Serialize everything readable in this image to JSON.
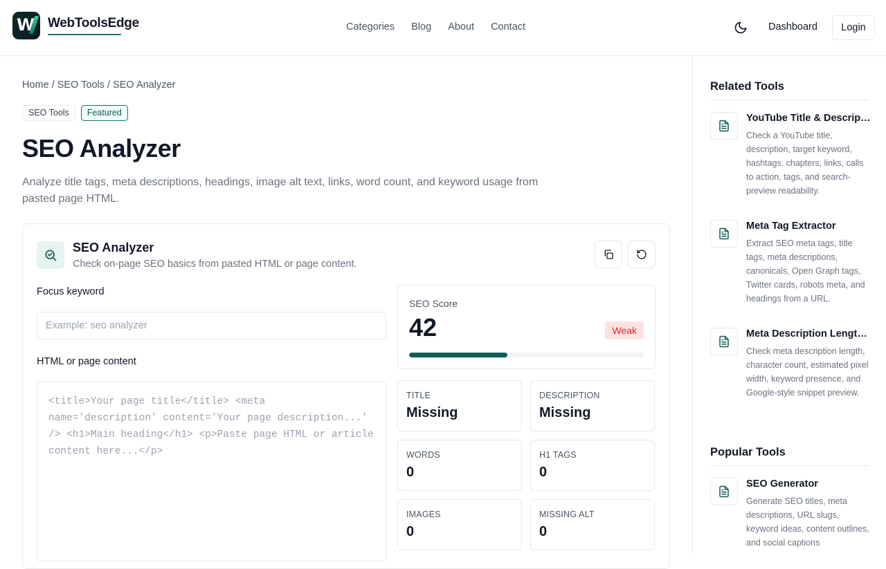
{
  "brand": {
    "name": "WebToolsEdge",
    "logo_letter": "W"
  },
  "nav": {
    "items": [
      "Categories",
      "Blog",
      "About",
      "Contact"
    ]
  },
  "header": {
    "theme_icon": "moon-icon",
    "dashboard_label": "Dashboard",
    "login_label": "Login"
  },
  "breadcrumb": "Home / SEO Tools / SEO Analyzer",
  "badges": [
    "SEO Tools",
    "Featured"
  ],
  "page": {
    "title": "SEO Analyzer",
    "subtitle": "Analyze title tags, meta descriptions, headings, image alt text, links, word count, and keyword usage from pasted page HTML."
  },
  "tool": {
    "title": "SEO Analyzer",
    "description": "Check on-page SEO basics from pasted HTML or page content.",
    "icon": "search-analyze-icon",
    "copy_icon": "copy-icon",
    "reset_icon": "reset-icon",
    "keyword_label": "Focus keyword",
    "keyword_placeholder": "Example: seo analyzer",
    "content_label": "HTML or page content",
    "content_placeholder": "<title>Your page title</title> <meta name='description' content='Your page description...' /> <h1>Main heading</h1> <p>Paste page HTML or article content here...</p>"
  },
  "score": {
    "label": "SEO Score",
    "value": "42",
    "rating": "Weak",
    "progress": 0.42,
    "accent": "#0f5e55"
  },
  "stats": [
    {
      "label": "TITLE",
      "value": "Missing"
    },
    {
      "label": "DESCRIPTION",
      "value": "Missing"
    },
    {
      "label": "WORDS",
      "value": "0"
    },
    {
      "label": "H1 TAGS",
      "value": "0"
    },
    {
      "label": "IMAGES",
      "value": "0"
    },
    {
      "label": "MISSING ALT",
      "value": "0"
    }
  ],
  "sidebar": {
    "related_heading": "Related Tools",
    "related": [
      {
        "title": "YouTube Title & Description Checker",
        "description": "Check a YouTube title, description, target keyword, hashtags, chapters, links, calls to action, tags, and search-preview readability."
      },
      {
        "title": "Meta Tag Extractor",
        "description": "Extract SEO meta tags, title tags, meta descriptions, canonicals, Open Graph tags, Twitter cards, robots meta, and headings from a URL."
      },
      {
        "title": "Meta Description Length Checker",
        "description": "Check meta description length, character count, estimated pixel width, keyword presence, and Google-style snippet preview."
      }
    ],
    "popular_heading": "Popular Tools",
    "popular": [
      {
        "title": "SEO Generator",
        "description": "Generate SEO titles, meta descriptions, URL slugs, keyword ideas, content outlines, and social captions"
      }
    ]
  }
}
